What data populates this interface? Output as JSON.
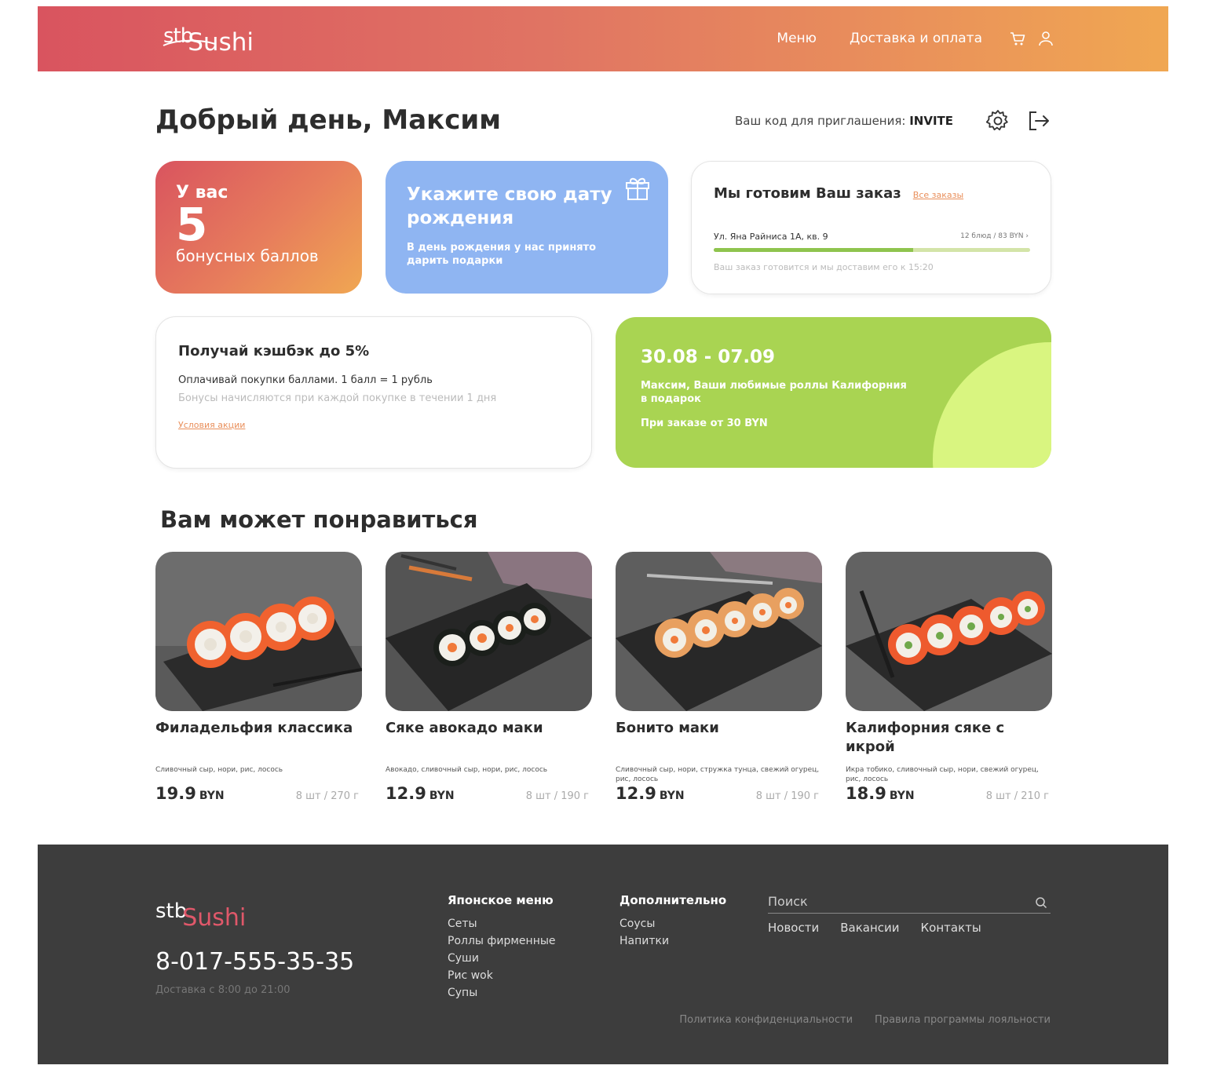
{
  "brand": {
    "logo_stb": "stb",
    "logo_sushi": "Sushi"
  },
  "header": {
    "nav": [
      "Меню",
      "Доставка и оплата"
    ],
    "cart_icon": "cart-icon",
    "user_icon": "user-icon"
  },
  "greeting": "Добрый день, Максим",
  "invite": {
    "label": "Ваш код для приглашения:",
    "code": "INVITE"
  },
  "bonus": {
    "line1": "У вас",
    "points": "5",
    "line3": "бонусных баллов"
  },
  "birthday": {
    "title": "Укажите свою дату рождения",
    "subtitle": "В день рождения у нас принято дарить подарки"
  },
  "order": {
    "title": "Мы готовим Ваш заказ",
    "all_orders": "Все заказы",
    "address": "Ул. Яна Райниса 1А, кв. 9",
    "meta": "12 блюд / 83 BYN",
    "progress": 0.63,
    "note": "Ваш заказ готовится и мы доставим его к 15:20"
  },
  "cashback": {
    "title": "Получай кэшбэк до 5%",
    "line1": "Оплачивай покупки баллами. 1 балл = 1 рубль",
    "line2": "Бонусы начисляются при каждой покупке в течении 1 дня",
    "link": "Условия акции"
  },
  "promo": {
    "dates": "30.08 - 07.09",
    "line1": "Максим, Ваши любимые роллы Калифорния в подарок",
    "line2": "При заказе от 30 BYN"
  },
  "recommendations": {
    "title": "Вам может понравиться",
    "products": [
      {
        "name": "Филадельфия классика",
        "desc": "Сливочный сыр, нори, рис, лосось",
        "price": "19.9",
        "currency": "BYN",
        "weight": "8 шт / 270 г"
      },
      {
        "name": "Сяке авокадо маки",
        "desc": "Авокадо, сливочный сыр, нори, рис, лосось",
        "price": "12.9",
        "currency": "BYN",
        "weight": "8 шт / 190 г"
      },
      {
        "name": "Бонито маки",
        "desc": "Сливочный сыр, нори, стружка тунца, свежий огурец, рис, лосось",
        "price": "12.9",
        "currency": "BYN",
        "weight": "8 шт / 190 г"
      },
      {
        "name": "Калифорния сяке с икрой",
        "desc": "Икра тобико, сливочный сыр, нори, свежий огурец, рис, лосось",
        "price": "18.9",
        "currency": "BYN",
        "weight": "8 шт / 210 г"
      }
    ]
  },
  "footer": {
    "phone": "8-017-555-35-35",
    "hours": "Доставка с 8:00 до 21:00",
    "col1": {
      "title": "Японское меню",
      "items": [
        "Сеты",
        "Роллы фирменные",
        "Суши",
        "Рис wok",
        "Супы"
      ]
    },
    "col2": {
      "title": "Дополнительно",
      "items": [
        "Соусы",
        "Напитки"
      ]
    },
    "search_placeholder": "Поиск",
    "links": [
      "Новости",
      "Вакансии",
      "Контакты"
    ],
    "legal": [
      "Политика конфиденциальности",
      "Правила программы лояльности"
    ]
  },
  "colors": {
    "accent_orange": "#e98f5b",
    "accent_red": "#d9545f",
    "blue_card": "#8fb5f2",
    "green_card": "#a9d452",
    "footer_bg": "#3d3d3d"
  }
}
